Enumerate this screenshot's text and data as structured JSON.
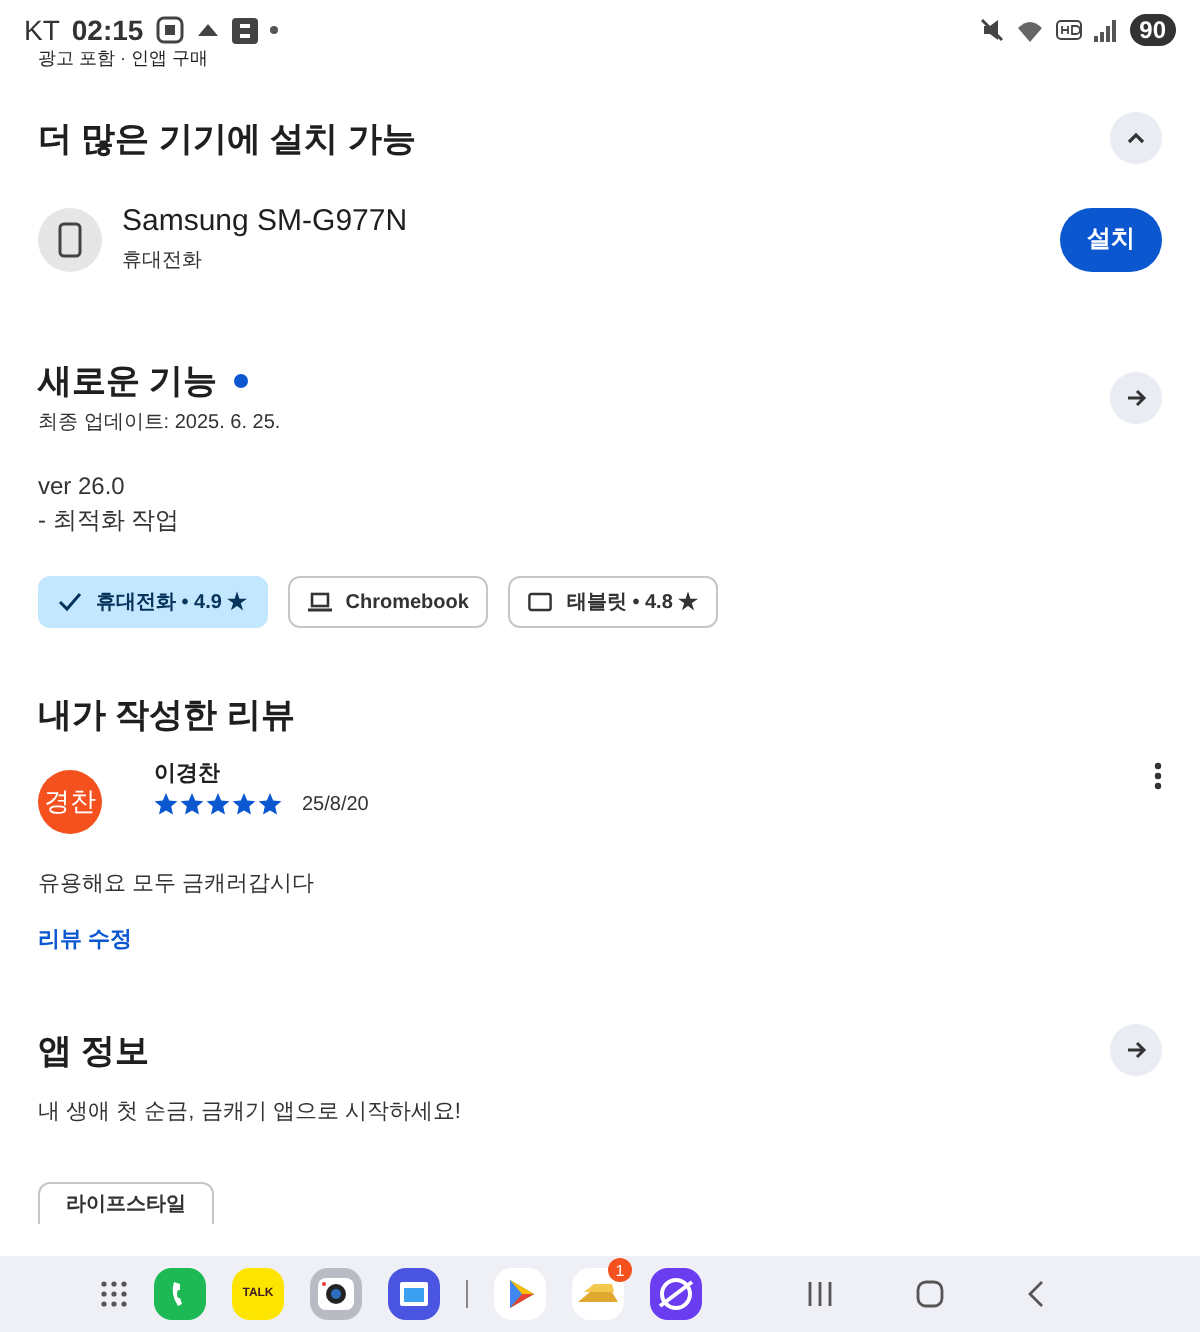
{
  "status_bar": {
    "carrier": "KT",
    "time": "02:15",
    "battery": "90"
  },
  "top_cut_text": "광고 포함 · 인앱 구매",
  "install_section": {
    "title": "더 많은 기기에 설치 가능",
    "expanded": true,
    "device": {
      "name": "Samsung SM-G977N",
      "type": "휴대전화",
      "button": "설치"
    }
  },
  "whats_new": {
    "title": "새로운 기능",
    "unread": true,
    "updated": "최종 업데이트: 2025. 6. 25.",
    "lines": [
      "ver 26.0",
      "- 최적화 작업"
    ]
  },
  "device_chips": [
    {
      "kind": "phone",
      "label": "휴대전화 • 4.9 ★",
      "selected": true
    },
    {
      "kind": "laptop",
      "label": "Chromebook",
      "selected": false
    },
    {
      "kind": "tablet",
      "label": "태블릿 • 4.8 ★",
      "selected": false
    }
  ],
  "my_review": {
    "title": "내가 작성한 리뷰",
    "avatar": "경찬",
    "author": "이경찬",
    "stars": 5,
    "date": "25/8/20",
    "text": "유용해요 모두 금캐러갑시다",
    "edit_link": "리뷰 수정"
  },
  "app_info": {
    "title": "앱 정보",
    "description": "내 생애 첫 순금, 금캐기 앱으로 시작하세요!",
    "tag": "라이프스타일"
  },
  "dock": {
    "apps": [
      {
        "kind": "grid"
      },
      {
        "kind": "phone"
      },
      {
        "kind": "talk",
        "label": "TALK"
      },
      {
        "kind": "camera"
      },
      {
        "kind": "window"
      },
      {
        "kind": "divider"
      },
      {
        "kind": "play"
      },
      {
        "kind": "gold",
        "badge": "1"
      },
      {
        "kind": "browser"
      }
    ]
  }
}
